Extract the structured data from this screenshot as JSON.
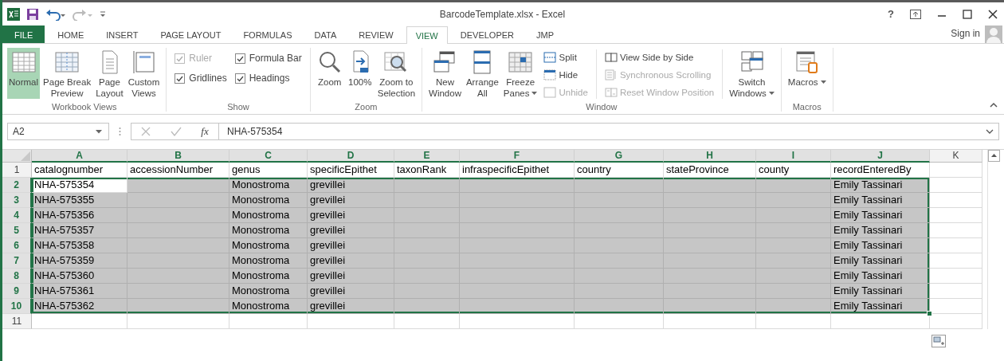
{
  "window": {
    "title": "BarcodeTemplate.xlsx - Excel",
    "help": "?",
    "sign_in": "Sign in"
  },
  "tabs": [
    {
      "label": "FILE",
      "kind": "file",
      "selected": false
    },
    {
      "label": "HOME",
      "kind": "tab",
      "selected": false
    },
    {
      "label": "INSERT",
      "kind": "tab",
      "selected": false
    },
    {
      "label": "PAGE LAYOUT",
      "kind": "tab",
      "selected": false
    },
    {
      "label": "FORMULAS",
      "kind": "tab",
      "selected": false
    },
    {
      "label": "DATA",
      "kind": "tab",
      "selected": false
    },
    {
      "label": "REVIEW",
      "kind": "tab",
      "selected": false
    },
    {
      "label": "VIEW",
      "kind": "tab",
      "selected": true
    },
    {
      "label": "DEVELOPER",
      "kind": "tab",
      "selected": false
    },
    {
      "label": "JMP",
      "kind": "tab",
      "selected": false
    }
  ],
  "ribbon": {
    "groups": [
      {
        "label": "Workbook Views",
        "items": [
          {
            "kind": "large",
            "lines": [
              "Normal"
            ],
            "selected": true,
            "dropdown": false
          },
          {
            "kind": "large",
            "lines": [
              "Page Break",
              "Preview"
            ],
            "selected": false,
            "dropdown": false
          },
          {
            "kind": "large",
            "lines": [
              "Page",
              "Layout"
            ],
            "selected": false,
            "dropdown": false
          },
          {
            "kind": "large",
            "lines": [
              "Custom",
              "Views"
            ],
            "selected": false,
            "dropdown": false
          }
        ]
      },
      {
        "label": "Show",
        "items": [
          {
            "kind": "stack",
            "items": [
              {
                "kind": "check",
                "label": "Ruler",
                "checked": true,
                "disabled": true
              },
              {
                "kind": "check",
                "label": "Gridlines",
                "checked": true,
                "disabled": false
              }
            ]
          },
          {
            "kind": "stack",
            "items": [
              {
                "kind": "check",
                "label": "Formula Bar",
                "checked": true,
                "disabled": false
              },
              {
                "kind": "check",
                "label": "Headings",
                "checked": true,
                "disabled": false
              }
            ]
          }
        ]
      },
      {
        "label": "Zoom",
        "items": [
          {
            "kind": "large",
            "lines": [
              "Zoom"
            ],
            "selected": false,
            "dropdown": false
          },
          {
            "kind": "large",
            "lines": [
              "100%"
            ],
            "selected": false,
            "dropdown": false
          },
          {
            "kind": "large",
            "lines": [
              "Zoom to",
              "Selection"
            ],
            "selected": false,
            "dropdown": false
          }
        ]
      },
      {
        "label": "Window",
        "items": [
          {
            "kind": "large",
            "lines": [
              "New",
              "Window"
            ],
            "selected": false,
            "dropdown": false
          },
          {
            "kind": "large",
            "lines": [
              "Arrange",
              "All"
            ],
            "selected": false,
            "dropdown": false
          },
          {
            "kind": "large",
            "lines": [
              "Freeze",
              "Panes"
            ],
            "selected": false,
            "dropdown": true
          },
          {
            "kind": "stack",
            "items": [
              {
                "kind": "small",
                "label": "Split",
                "disabled": false
              },
              {
                "kind": "small",
                "label": "Hide",
                "disabled": false
              },
              {
                "kind": "small",
                "label": "Unhide",
                "disabled": true
              }
            ]
          },
          {
            "kind": "stack",
            "items": [
              {
                "kind": "small",
                "label": "View Side by Side",
                "disabled": false
              },
              {
                "kind": "small",
                "label": "Synchronous Scrolling",
                "disabled": true
              },
              {
                "kind": "small",
                "label": "Reset Window Position",
                "disabled": true
              }
            ]
          },
          {
            "kind": "large",
            "lines": [
              "Switch",
              "Windows"
            ],
            "selected": false,
            "dropdown": true
          }
        ]
      },
      {
        "label": "Macros",
        "items": [
          {
            "kind": "large",
            "lines": [
              "Macros"
            ],
            "selected": false,
            "dropdown": true
          }
        ]
      }
    ]
  },
  "formula_bar": {
    "name_box": "A2",
    "function_button": "fx",
    "value": "NHA-575354"
  },
  "sheet": {
    "columns": [
      {
        "label": "A",
        "selected": true
      },
      {
        "label": "B",
        "selected": true
      },
      {
        "label": "C",
        "selected": true
      },
      {
        "label": "D",
        "selected": true
      },
      {
        "label": "E",
        "selected": true
      },
      {
        "label": "F",
        "selected": true
      },
      {
        "label": "G",
        "selected": true
      },
      {
        "label": "H",
        "selected": true
      },
      {
        "label": "I",
        "selected": true
      },
      {
        "label": "J",
        "selected": true
      },
      {
        "label": "K",
        "selected": false
      }
    ],
    "rows": [
      {
        "number": "1",
        "selected": false,
        "cells": [
          {
            "value": "catalognumber",
            "selected": false
          },
          {
            "value": "accessionNumber",
            "selected": false
          },
          {
            "value": "genus",
            "selected": false
          },
          {
            "value": "specificEpithet",
            "selected": false
          },
          {
            "value": "taxonRank",
            "selected": false
          },
          {
            "value": "infraspecificEpithet",
            "selected": false
          },
          {
            "value": "country",
            "selected": false
          },
          {
            "value": "stateProvince",
            "selected": false
          },
          {
            "value": "county",
            "selected": false
          },
          {
            "value": "recordEnteredBy",
            "selected": false
          },
          {
            "selected": false
          }
        ]
      },
      {
        "number": "2",
        "selected": true,
        "cells": [
          {
            "value": "NHA-575354",
            "selected": false
          },
          {
            "selected": true
          },
          {
            "value": "Monostroma",
            "selected": true
          },
          {
            "value": "grevillei",
            "selected": true
          },
          {
            "selected": true
          },
          {
            "selected": true
          },
          {
            "selected": true
          },
          {
            "selected": true
          },
          {
            "selected": true
          },
          {
            "value": "Emily Tassinari",
            "selected": true
          },
          {
            "selected": false
          }
        ]
      },
      {
        "number": "3",
        "selected": true,
        "cells": [
          {
            "value": "NHA-575355",
            "selected": true
          },
          {
            "selected": true
          },
          {
            "value": "Monostroma",
            "selected": true
          },
          {
            "value": "grevillei",
            "selected": true
          },
          {
            "selected": true
          },
          {
            "selected": true
          },
          {
            "selected": true
          },
          {
            "selected": true
          },
          {
            "selected": true
          },
          {
            "value": "Emily Tassinari",
            "selected": true
          },
          {
            "selected": false
          }
        ]
      },
      {
        "number": "4",
        "selected": true,
        "cells": [
          {
            "value": "NHA-575356",
            "selected": true
          },
          {
            "selected": true
          },
          {
            "value": "Monostroma",
            "selected": true
          },
          {
            "value": "grevillei",
            "selected": true
          },
          {
            "selected": true
          },
          {
            "selected": true
          },
          {
            "selected": true
          },
          {
            "selected": true
          },
          {
            "selected": true
          },
          {
            "value": "Emily Tassinari",
            "selected": true
          },
          {
            "selected": false
          }
        ]
      },
      {
        "number": "5",
        "selected": true,
        "cells": [
          {
            "value": "NHA-575357",
            "selected": true
          },
          {
            "selected": true
          },
          {
            "value": "Monostroma",
            "selected": true
          },
          {
            "value": "grevillei",
            "selected": true
          },
          {
            "selected": true
          },
          {
            "selected": true
          },
          {
            "selected": true
          },
          {
            "selected": true
          },
          {
            "selected": true
          },
          {
            "value": "Emily Tassinari",
            "selected": true
          },
          {
            "selected": false
          }
        ]
      },
      {
        "number": "6",
        "selected": true,
        "cells": [
          {
            "value": "NHA-575358",
            "selected": true
          },
          {
            "selected": true
          },
          {
            "value": "Monostroma",
            "selected": true
          },
          {
            "value": "grevillei",
            "selected": true
          },
          {
            "selected": true
          },
          {
            "selected": true
          },
          {
            "selected": true
          },
          {
            "selected": true
          },
          {
            "selected": true
          },
          {
            "value": "Emily Tassinari",
            "selected": true
          },
          {
            "selected": false
          }
        ]
      },
      {
        "number": "7",
        "selected": true,
        "cells": [
          {
            "value": "NHA-575359",
            "selected": true
          },
          {
            "selected": true
          },
          {
            "value": "Monostroma",
            "selected": true
          },
          {
            "value": "grevillei",
            "selected": true
          },
          {
            "selected": true
          },
          {
            "selected": true
          },
          {
            "selected": true
          },
          {
            "selected": true
          },
          {
            "selected": true
          },
          {
            "value": "Emily Tassinari",
            "selected": true
          },
          {
            "selected": false
          }
        ]
      },
      {
        "number": "8",
        "selected": true,
        "cells": [
          {
            "value": "NHA-575360",
            "selected": true
          },
          {
            "selected": true
          },
          {
            "value": "Monostroma",
            "selected": true
          },
          {
            "value": "grevillei",
            "selected": true
          },
          {
            "selected": true
          },
          {
            "selected": true
          },
          {
            "selected": true
          },
          {
            "selected": true
          },
          {
            "selected": true
          },
          {
            "value": "Emily Tassinari",
            "selected": true
          },
          {
            "selected": false
          }
        ]
      },
      {
        "number": "9",
        "selected": true,
        "cells": [
          {
            "value": "NHA-575361",
            "selected": true
          },
          {
            "selected": true
          },
          {
            "value": "Monostroma",
            "selected": true
          },
          {
            "value": "grevillei",
            "selected": true
          },
          {
            "selected": true
          },
          {
            "selected": true
          },
          {
            "selected": true
          },
          {
            "selected": true
          },
          {
            "selected": true
          },
          {
            "value": "Emily Tassinari",
            "selected": true
          },
          {
            "selected": false
          }
        ]
      },
      {
        "number": "10",
        "selected": true,
        "cells": [
          {
            "value": "NHA-575362",
            "selected": true
          },
          {
            "selected": true
          },
          {
            "value": "Monostroma",
            "selected": true
          },
          {
            "value": "grevillei",
            "selected": true
          },
          {
            "selected": true
          },
          {
            "selected": true
          },
          {
            "selected": true
          },
          {
            "selected": true
          },
          {
            "selected": true
          },
          {
            "value": "Emily Tassinari",
            "selected": true
          },
          {
            "selected": false
          }
        ]
      },
      {
        "number": "11",
        "selected": false,
        "cells": [
          {
            "selected": false
          },
          {
            "selected": false
          },
          {
            "selected": false
          },
          {
            "selected": false
          },
          {
            "selected": false
          },
          {
            "selected": false
          },
          {
            "selected": false
          },
          {
            "selected": false
          },
          {
            "selected": false
          },
          {
            "selected": false
          },
          {
            "selected": false
          }
        ]
      }
    ]
  }
}
